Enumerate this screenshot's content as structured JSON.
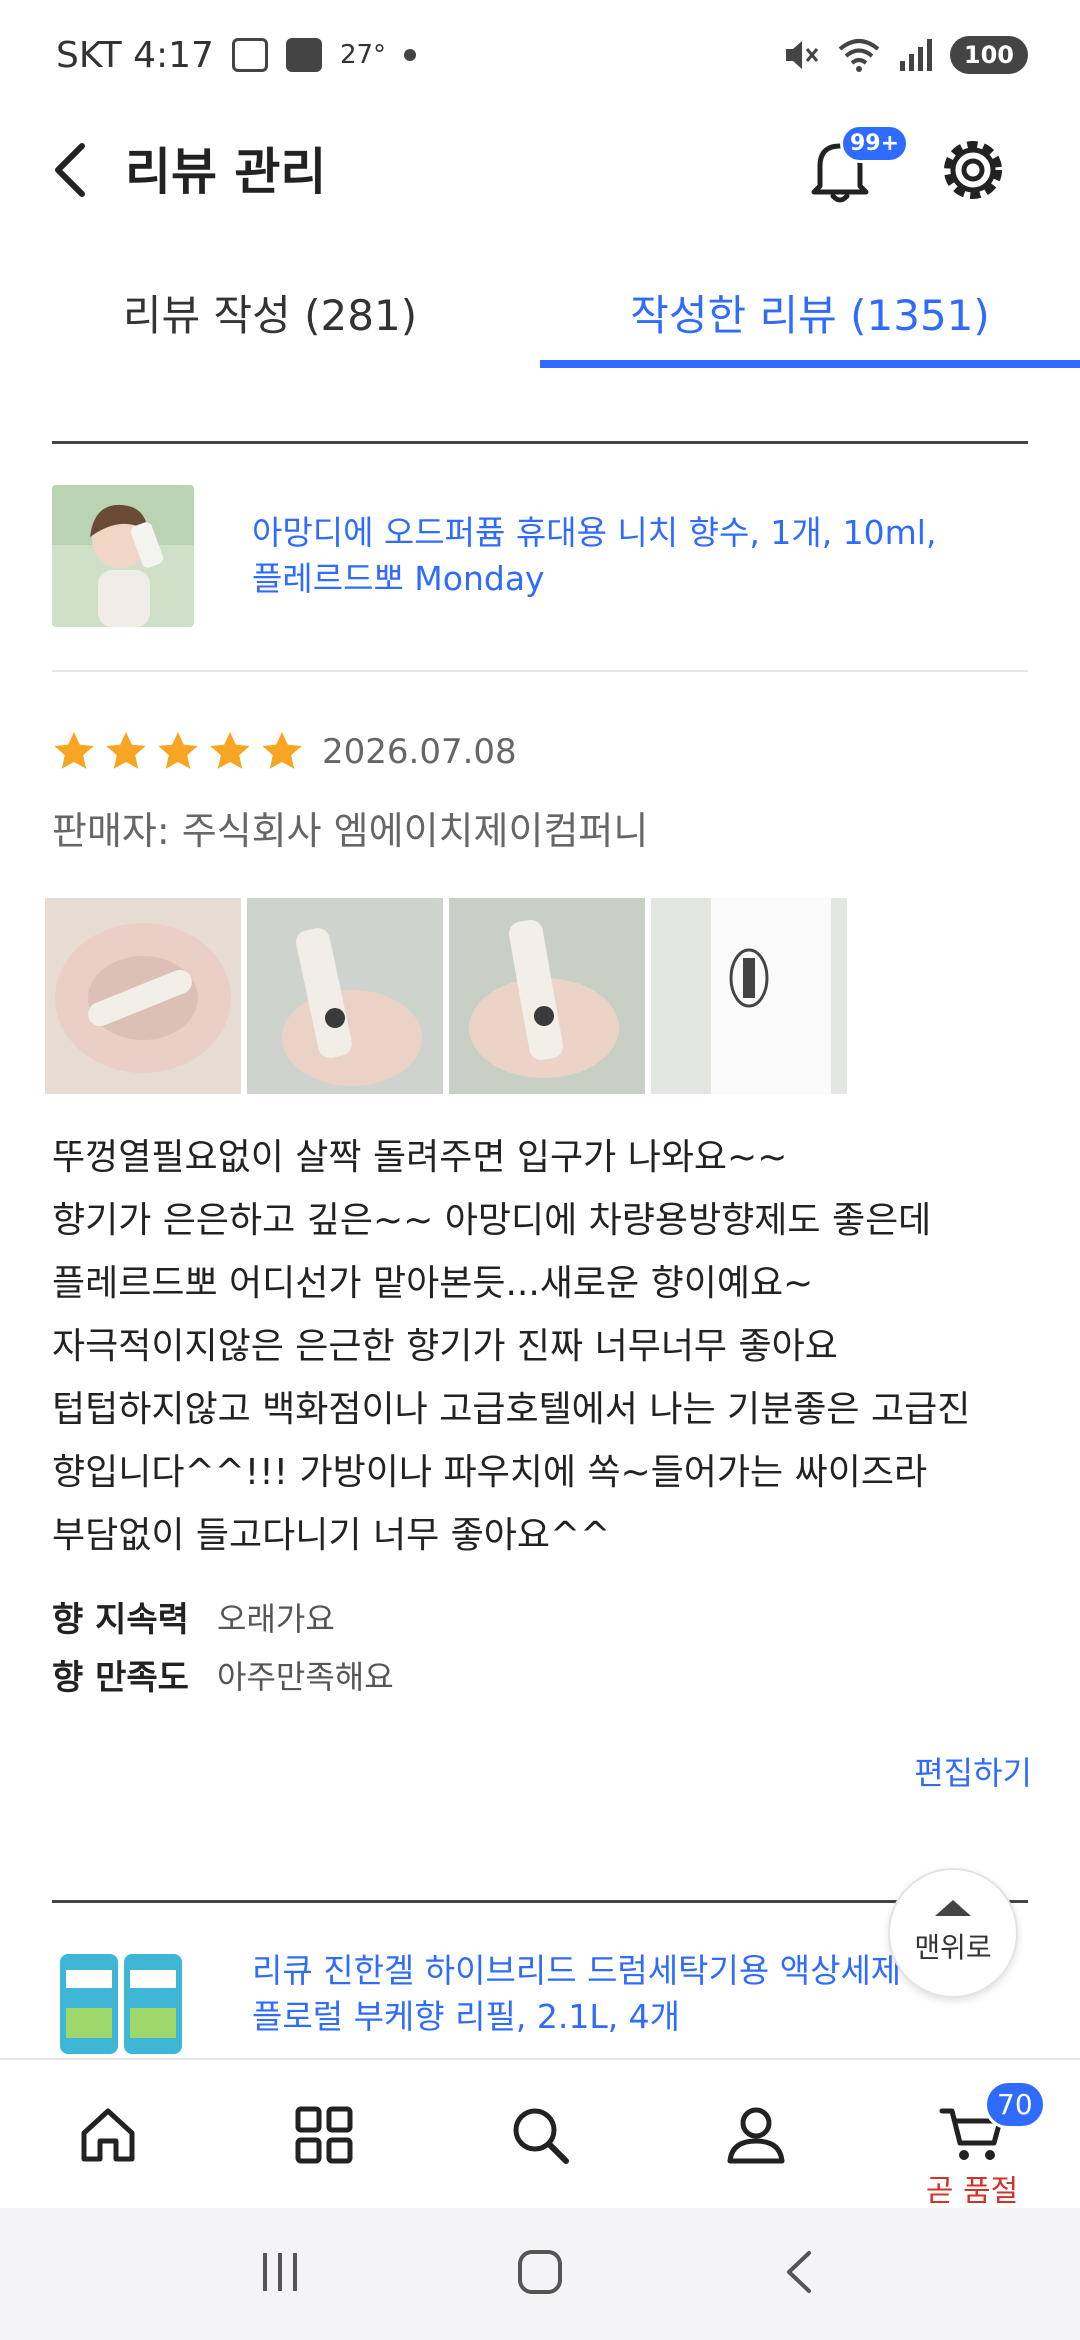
{
  "status_bar": {
    "carrier_time": "SKT 4:17",
    "temperature": "27°",
    "battery": "100",
    "icons": [
      "screenshot-icon",
      "pay-icon",
      "dot-icon",
      "mute-icon",
      "wifi-icon",
      "signal-icon"
    ]
  },
  "header": {
    "title": "리뷰 관리",
    "notification_badge": "99+"
  },
  "tabs": [
    {
      "label": "리뷰 작성 (281)",
      "active": false
    },
    {
      "label": "작성한 리뷰 (1351)",
      "active": true
    }
  ],
  "colors": {
    "accent": "#2f6bff",
    "star": "#f6a623",
    "alert": "#d6302a"
  },
  "reviews": [
    {
      "product_line1": "아망디에 오드퍼퓸 휴대용 니치 향수, 1개, 10ml,",
      "product_line2": "플레르드뽀 Monday",
      "rating": 5,
      "date": "2026.07.08",
      "seller": "판매자: 주식회사 엠에이치제이컴퍼니",
      "photo_count": 4,
      "text_lines": [
        "뚜껑열필요없이 살짝 돌려주면 입구가 나와요~~",
        "향기가 은은하고 깊은~~ 아망디에 차량용방향제도 좋은데",
        "플레르드뽀 어디선가 맡아본듯...새로운 향이예요~",
        "자극적이지않은 은근한 향기가 진짜 너무너무 좋아요",
        "텁텁하지않고 백화점이나 고급호텔에서 나는 기분좋은 고급진",
        "향입니다^^!!! 가방이나 파우치에 쏙~들어가는 싸이즈라",
        "부담없이 들고다니기 너무 좋아요^^"
      ],
      "attributes": [
        {
          "key": "향 지속력",
          "value": "오래가요"
        },
        {
          "key": "향 만족도",
          "value": "아주만족해요"
        }
      ],
      "edit_label": "편집하기"
    },
    {
      "product_line1": "리큐 진한겔 하이브리드 드럼세탁기용 액상세제",
      "product_line2": "플로럴 부케향 리필, 2.1L, 4개"
    }
  ],
  "scroll_top_label": "맨위로",
  "bottom_nav": {
    "items": [
      "home-icon",
      "category-icon",
      "search-icon",
      "profile-icon",
      "cart-icon"
    ],
    "cart_badge": "70",
    "cart_label": "곧 품절"
  },
  "system_nav": [
    "recent-apps-icon",
    "home-button-icon",
    "back-icon"
  ]
}
